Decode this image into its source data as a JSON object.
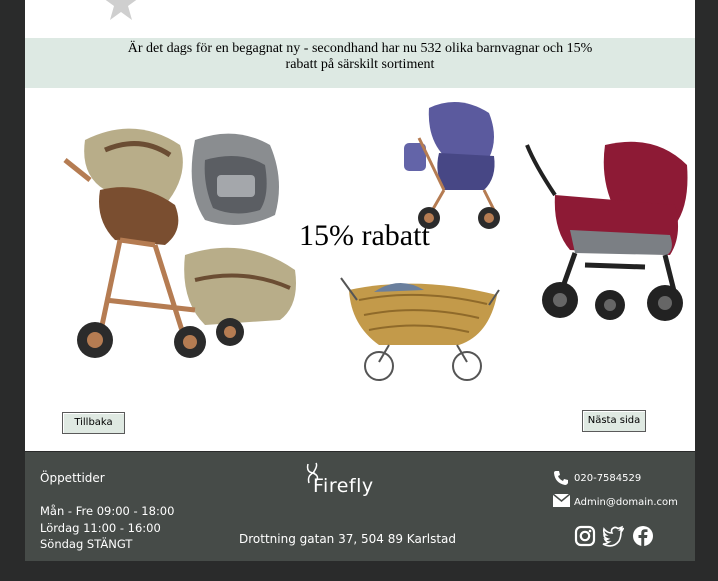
{
  "banner": {
    "line1": "Är det dags för en begagnat ny - secondhand har nu 532 olika barnvagnar och 15%",
    "line2": "rabatt på särskilt sortiment"
  },
  "promo": {
    "label": "15% rabatt"
  },
  "nav": {
    "back_label": "Tillbaka",
    "next_label": "Nästa sida"
  },
  "footer": {
    "hours_title": "Öppettider",
    "hours": [
      "Mån - Fre  09:00 - 18:00",
      "Lördag 11:00 - 16:00",
      "Söndag STÄNGT"
    ],
    "brand": "Firefly",
    "address": "Drottning gatan 37,  504 89 Karlstad",
    "phone": "020-7584529",
    "email": "Admin@domain.com"
  },
  "icons": {
    "star": "star-icon",
    "phone": "phone-icon",
    "mail": "mail-icon",
    "instagram": "instagram-icon",
    "twitter": "twitter-icon",
    "facebook": "facebook-icon"
  },
  "colors": {
    "banner_bg": "#dde9e3",
    "footer_bg": "#464b48",
    "page_bg": "#2a2b2b"
  }
}
